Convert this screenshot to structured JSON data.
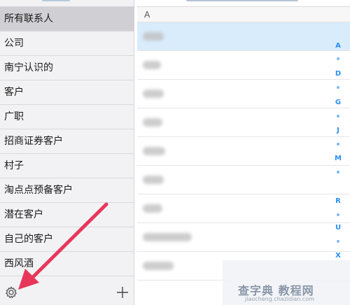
{
  "sidebar": {
    "groups": [
      {
        "label": "所有联系人",
        "selected": true
      },
      {
        "label": "公司"
      },
      {
        "label": "南宁认识的"
      },
      {
        "label": "客户"
      },
      {
        "label": "广职"
      },
      {
        "label": "招商证券客户"
      },
      {
        "label": "村子"
      },
      {
        "label": "淘点点预备客户"
      },
      {
        "label": "潜在客户"
      },
      {
        "label": "自己的客户"
      },
      {
        "label": "西风酒"
      }
    ],
    "toolbar": {
      "settings_icon": "gear-icon",
      "add_icon": "plus-icon"
    }
  },
  "contacts": {
    "section_header": "A",
    "rows_blurred": 9
  },
  "index_bar": {
    "letters": [
      "A",
      "D",
      "G",
      "J",
      "M",
      "R",
      "U",
      "X"
    ]
  },
  "watermark": {
    "title": "查字典 教程网",
    "subtitle": "jiaocheng.chazidian.com"
  },
  "colors": {
    "selected_group": "#d0d0d4",
    "selected_contact": "#d9ecfb",
    "index_blue": "#2a8ff7",
    "annotation_arrow": "#e8365b"
  }
}
